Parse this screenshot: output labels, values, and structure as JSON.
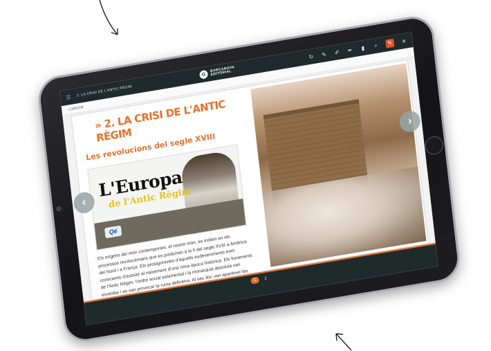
{
  "app": {
    "breadcrumb": "2. LA CRISI DE L'ANTIC RÈGIM",
    "logo_mark": "G",
    "logo_line1": "BARCANOVA",
    "logo_line2": "EDITORIAL",
    "back_label": "‹ CARCHE"
  },
  "toolbar": {
    "icons": [
      "refresh-icon",
      "pencil-icon",
      "marker-icon",
      "highlighter-icon",
      "bookmark-icon",
      "search-icon",
      "edit-icon",
      "close-icon"
    ],
    "glyphs": [
      "↻",
      "✎",
      "✐",
      "✒",
      "▮",
      "⌕",
      "✎",
      "✕"
    ]
  },
  "page": {
    "chapter_title": "» 2. LA CRISI DE L'ANTIC RÈGIM",
    "section_title": "Les revolucions del segle XVIII",
    "video_title": "L'Europa",
    "video_subtitle": "de l'Antic Règim",
    "video_badge": "Qé",
    "body_text": "Els orígens del món contemporani, el nostre món, es troben en els processos revolucionaris que es produïren a la fi del segle XVIII a Amèrica del Nord i a França. Els protagonistes d'aquells esdeveniments eren conscients d'assistir al naixement d'una nova època històrica. Els fonaments de l'Antic Règim, l'ordre social estamental i la monarquia absoluta van trontollar i es van provocar la ruina definitiva. Al seu lloc van aparèixer les bases de la nova política, els sistemes socials i els corrents"
  },
  "pager": {
    "current": "1",
    "next": "2"
  },
  "nav": {
    "prev_glyph": "‹",
    "next_glyph": "›"
  },
  "colors": {
    "accent": "#e8702a",
    "toolbar": "#1f2a2b",
    "active_tool": "#e8512c"
  }
}
